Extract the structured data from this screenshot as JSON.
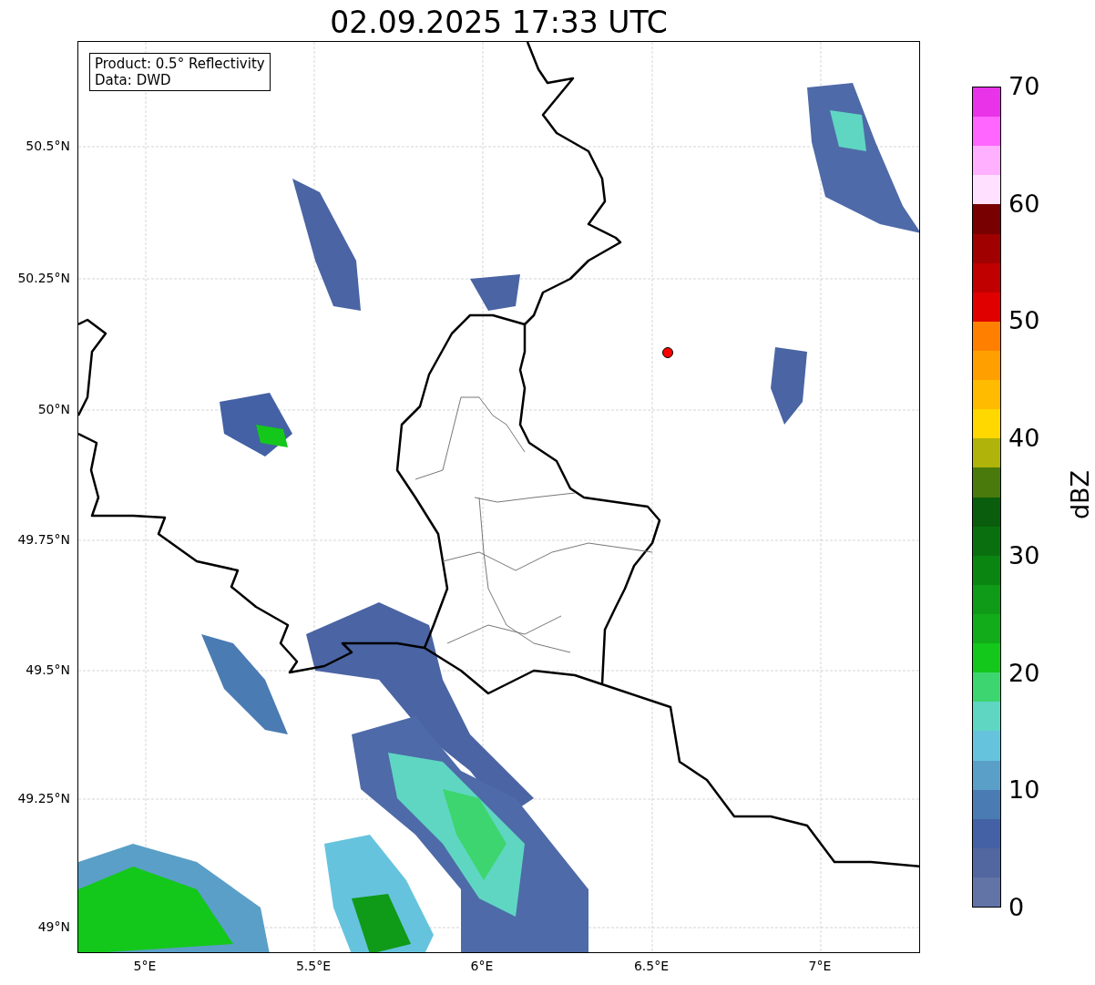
{
  "title": "02.09.2025 17:33 UTC",
  "legend": [
    "Product: 0.5° Reflectivity",
    "Data: DWD"
  ],
  "y_axis": {
    "ticks": [
      "50.5°N",
      "50.25°N",
      "50°N",
      "49.75°N",
      "49.5°N",
      "49.25°N",
      "49°N"
    ]
  },
  "x_axis": {
    "ticks": [
      "5°E",
      "5.5°E",
      "6°E",
      "6.5°E",
      "7°E"
    ]
  },
  "colorbar": {
    "label": "dBZ",
    "ticks": [
      "70",
      "60",
      "50",
      "40",
      "30",
      "20",
      "10",
      "0"
    ],
    "segments": [
      {
        "color": "#e833e8"
      },
      {
        "color": "#ff66ff"
      },
      {
        "color": "#ffb0ff"
      },
      {
        "color": "#ffe0ff"
      },
      {
        "color": "#780000"
      },
      {
        "color": "#a00000"
      },
      {
        "color": "#c00000"
      },
      {
        "color": "#e00000"
      },
      {
        "color": "#ff8000"
      },
      {
        "color": "#ff9f00"
      },
      {
        "color": "#ffbb00"
      },
      {
        "color": "#ffd800"
      },
      {
        "color": "#b0b30a"
      },
      {
        "color": "#4a7a0c"
      },
      {
        "color": "#0a5d0c"
      },
      {
        "color": "#0a700f"
      },
      {
        "color": "#0b8512"
      },
      {
        "color": "#0f9a17"
      },
      {
        "color": "#12ac1a"
      },
      {
        "color": "#13c81a"
      },
      {
        "color": "#3dd56f"
      },
      {
        "color": "#5fd6c2"
      },
      {
        "color": "#66c3dd"
      },
      {
        "color": "#5a9fc8"
      },
      {
        "color": "#4a7bb3"
      },
      {
        "color": "#4361a4"
      },
      {
        "color": "#52679f"
      },
      {
        "color": "#6273a6"
      }
    ]
  }
}
